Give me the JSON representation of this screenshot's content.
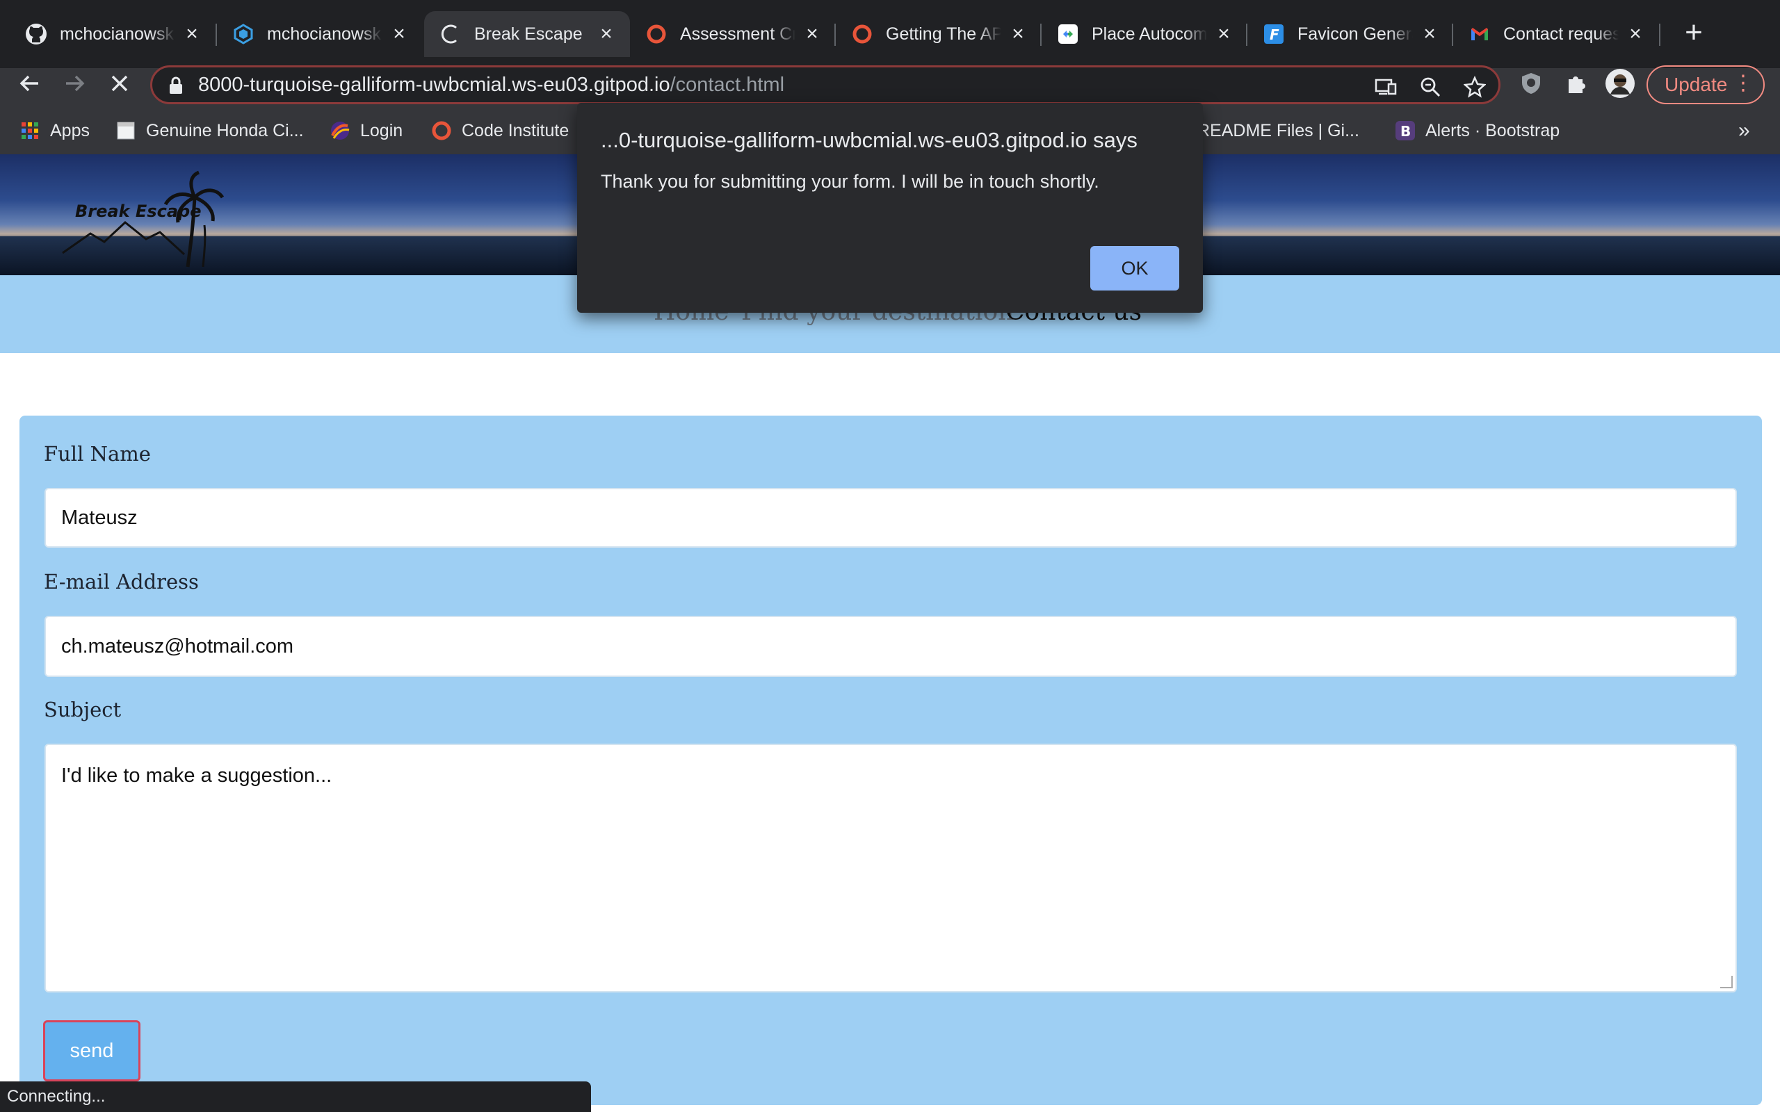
{
  "browser": {
    "tabs": [
      {
        "title": "mchocianowsk",
        "icon": "github-icon",
        "active": false
      },
      {
        "title": "mchocianowsk",
        "icon": "gitpod-icon",
        "active": false
      },
      {
        "title": "Break Escape",
        "icon": "loading-spinner-icon",
        "active": true
      },
      {
        "title": "Assessment Cr",
        "icon": "code-institute-icon",
        "active": false
      },
      {
        "title": "Getting The AP",
        "icon": "code-institute-icon",
        "active": false
      },
      {
        "title": "Place Autocom",
        "icon": "google-dev-icon",
        "active": false
      },
      {
        "title": "Favicon Genera",
        "icon": "favicon-generator-icon",
        "active": false
      },
      {
        "title": "Contact reques",
        "icon": "gmail-icon",
        "active": false
      }
    ],
    "address": {
      "host": "8000-turquoise-galliform-uwbcmial.ws-eu03.gitpod.io",
      "path": "/contact.html"
    },
    "update_label": "Update",
    "bookmarks": [
      {
        "label": "Apps",
        "icon": "apps-grid-icon"
      },
      {
        "label": "Genuine Honda Ci...",
        "icon": "page-icon"
      },
      {
        "label": "Login",
        "icon": "login-icon"
      },
      {
        "label": "Code Institute",
        "icon": "code-institute-icon"
      },
      {
        "label": "README Files | Gi...",
        "icon": "readme-icon"
      },
      {
        "label": "Alerts · Bootstrap",
        "icon": "bootstrap-icon"
      }
    ],
    "more_bookmarks": "»",
    "status": "Connecting..."
  },
  "site": {
    "logo": "Break Escape",
    "nav": [
      {
        "label": "Home",
        "current": false
      },
      {
        "label": "Find your destination",
        "current": false
      },
      {
        "label": "Contact us",
        "current": true
      }
    ]
  },
  "form": {
    "name_label": "Full Name",
    "name_value": "Mateusz",
    "email_label": "E-mail Address",
    "email_value": "ch.mateusz@hotmail.com",
    "subject_label": "Subject",
    "subject_value": "I'd like to make a suggestion...",
    "send_label": "send"
  },
  "dialog": {
    "title": "...0-turquoise-galliform-uwbcmial.ws-eu03.gitpod.io says",
    "message": "Thank you for submitting your form. I will be in touch shortly.",
    "ok_label": "OK"
  },
  "colors": {
    "accent": "#8ab4f8",
    "nav_bg": "#9ecff3",
    "send_bg": "#64b1ee",
    "update_red": "#f28b82"
  }
}
